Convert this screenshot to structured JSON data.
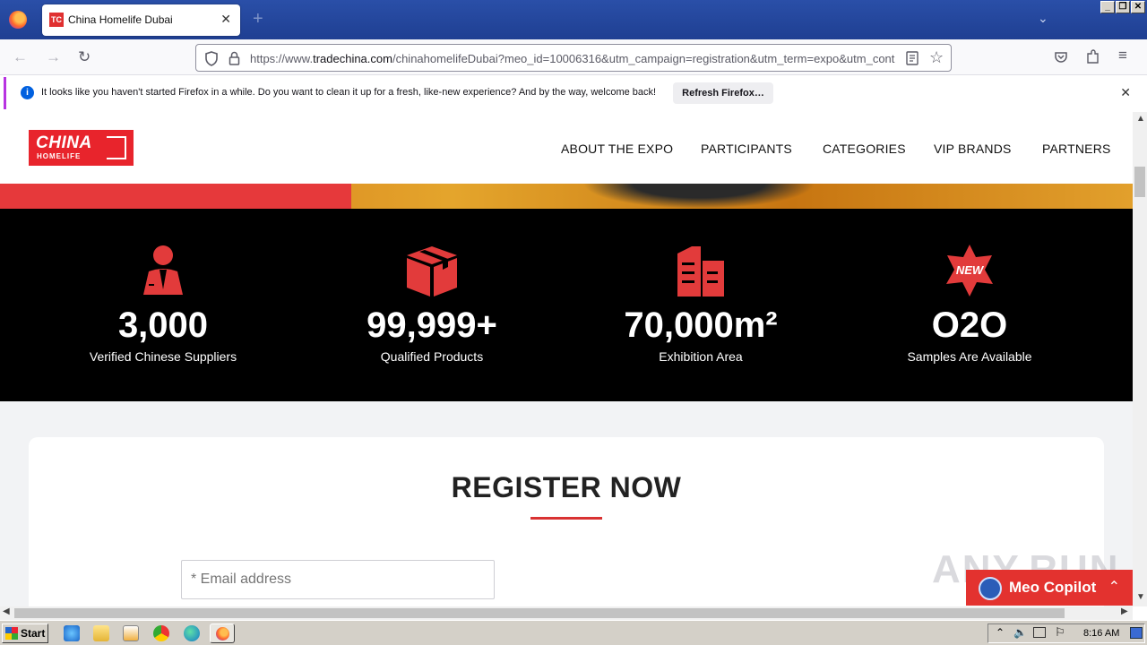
{
  "browser": {
    "tab_title": "China Homelife Dubai",
    "tab_favicon": "TC",
    "new_tab": "+",
    "url_prefix": "https://www.",
    "url_domain": "tradechina.com",
    "url_rest": "/chinahomelifeDubai?meo_id=10006316&utm_campaign=registration&utm_term=expo&utm_cont"
  },
  "notification": {
    "text": "It looks like you haven't started Firefox in a while. Do you want to clean it up for a fresh, like-new experience? And by the way, welcome back!",
    "button": "Refresh Firefox…"
  },
  "site": {
    "logo_china": "CHINA",
    "logo_homelife": "HOMELIFE",
    "menu": [
      "ABOUT THE EXPO",
      "PARTICIPANTS",
      "CATEGORIES",
      "VIP BRANDS",
      "PARTNERS"
    ]
  },
  "stats": [
    {
      "icon": "supplier-person-icon",
      "value": "3,000",
      "label": "Verified Chinese Suppliers"
    },
    {
      "icon": "product-box-icon",
      "value": "99,999+",
      "label": "Qualified Products"
    },
    {
      "icon": "building-icon",
      "value": "70,000m²",
      "label": "Exhibition Area"
    },
    {
      "icon": "new-badge-icon",
      "value": "O2O",
      "label": "Samples Are Available",
      "badge_text": "NEW"
    }
  ],
  "register": {
    "title": "REGISTER NOW",
    "email_placeholder": "* Email address"
  },
  "copilot": {
    "label": "Meo Copilot"
  },
  "watermark": "ANY.RUN",
  "taskbar": {
    "start": "Start",
    "clock": "8:16 AM"
  },
  "colors": {
    "brand_red": "#e8242c",
    "stats_bg": "#000000",
    "tab_bar": "#1f3f92"
  }
}
